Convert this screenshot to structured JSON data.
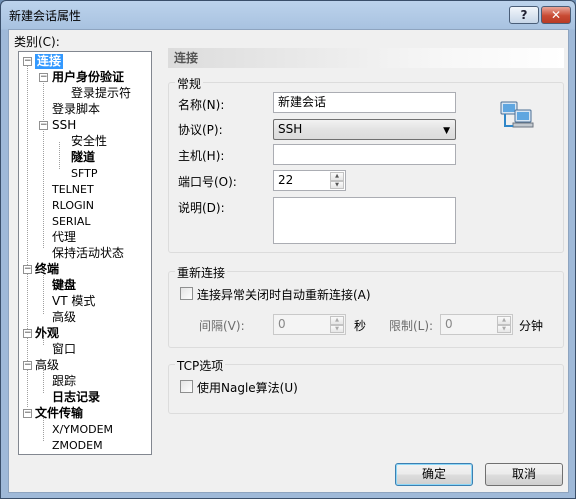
{
  "window": {
    "title": "新建会话属性",
    "help_label": "?",
    "close_label": "✕"
  },
  "category_label": "类别(C):",
  "tree": {
    "connection": "连接",
    "user_auth": "用户身份验证",
    "login_prompt": "登录提示符",
    "login_script": "登录脚本",
    "ssh": "SSH",
    "security": "安全性",
    "tunnel": "隧道",
    "sftp": "SFTP",
    "telnet": "TELNET",
    "rlogin": "RLOGIN",
    "serial": "SERIAL",
    "proxy": "代理",
    "keepalive": "保持活动状态",
    "terminal": "终端",
    "keyboard": "键盘",
    "vt_mode": "VT 模式",
    "terminal_advanced": "高级",
    "appearance": "外观",
    "window": "窗口",
    "advanced": "高级",
    "trace": "跟踪",
    "logging": "日志记录",
    "file_transfer": "文件传输",
    "xymodem": "X/YMODEM",
    "zmodem": "ZMODEM",
    "expand_minus": "−"
  },
  "panel": {
    "header": "连接",
    "general": {
      "title": "常规",
      "name_label": "名称(N):",
      "name_value": "新建会话",
      "protocol_label": "协议(P):",
      "protocol_value": "SSH",
      "host_label": "主机(H):",
      "host_value": "",
      "port_label": "端口号(O):",
      "port_value": "22",
      "desc_label": "说明(D):",
      "desc_value": ""
    },
    "reconnect": {
      "title": "重新连接",
      "auto_reconnect_label": "连接异常关闭时自动重新连接(A)",
      "interval_label": "间隔(V):",
      "interval_value": "0",
      "interval_unit": "秒",
      "limit_label": "限制(L):",
      "limit_value": "0",
      "limit_unit": "分钟"
    },
    "tcp": {
      "title": "TCP选项",
      "nagle_label": "使用Nagle算法(U)"
    }
  },
  "buttons": {
    "ok": "确定",
    "cancel": "取消"
  },
  "icons": {
    "network": "network-computers-icon",
    "dropdown": "chevron-down-icon"
  },
  "colors": {
    "selection": "#3399ff",
    "titlebar": "#bcd3ec",
    "close_button": "#c84a33"
  }
}
